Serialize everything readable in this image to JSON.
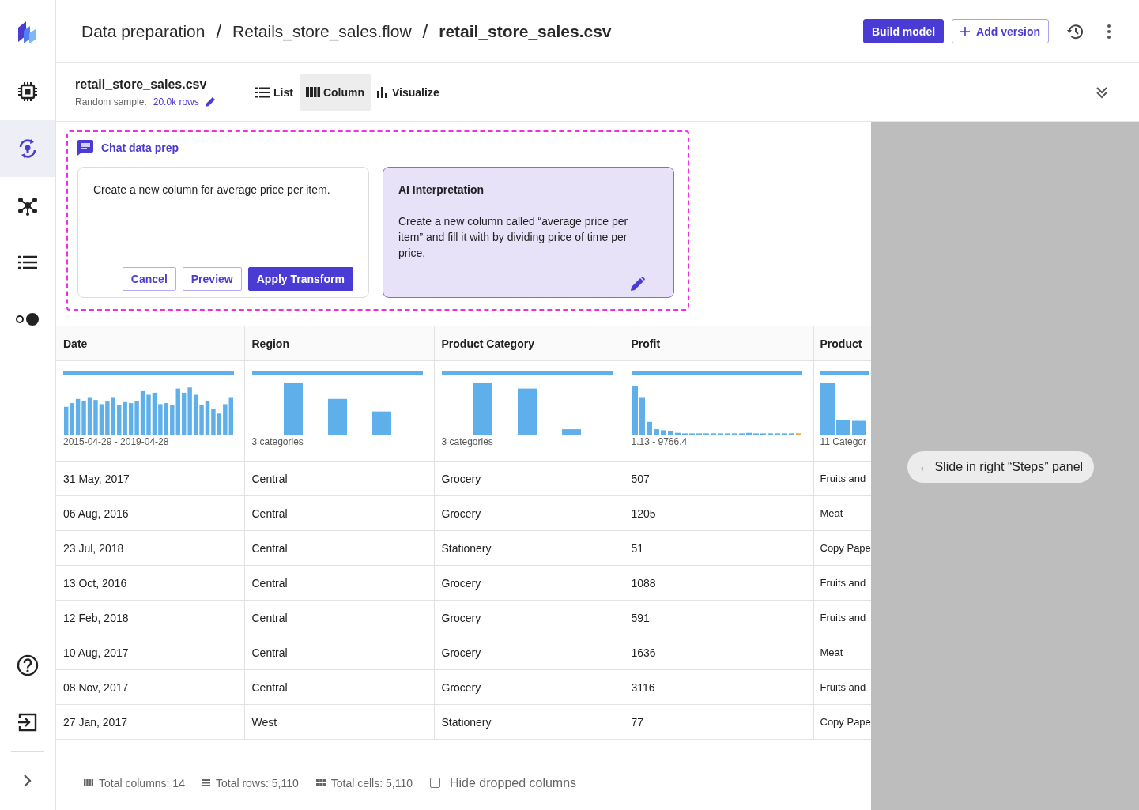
{
  "breadcrumb": {
    "separator": "/",
    "items": [
      {
        "label": "Data preparation",
        "current": false
      },
      {
        "label": "Retails_store_sales.flow",
        "current": false
      },
      {
        "label": "retail_store_sales.csv",
        "current": true
      }
    ]
  },
  "actions": {
    "primary": "Build model",
    "secondary": "Add version"
  },
  "sidebar": {
    "top": [
      {
        "kind": "chip",
        "selected": false
      },
      {
        "kind": "cycle",
        "selected": true
      },
      {
        "kind": "network",
        "selected": false
      },
      {
        "kind": "list",
        "selected": false
      },
      {
        "kind": "toggle",
        "selected": false
      }
    ],
    "bottom": [
      {
        "kind": "help"
      },
      {
        "kind": "exit"
      },
      {
        "kind": "expand"
      }
    ]
  },
  "dataset": {
    "name": "retail_store_sales.csv",
    "sample_label": "Random sample:",
    "sample_value": "20.0k rows"
  },
  "views": [
    {
      "label": "List",
      "kind": "list",
      "selected": false
    },
    {
      "label": "Column",
      "kind": "column",
      "selected": true
    },
    {
      "label": "Visualize",
      "kind": "visualize",
      "selected": false
    }
  ],
  "chat": {
    "title": "Chat data prep",
    "prompt": "Create a new column for average price per item.",
    "buttons": [
      {
        "label": "Cancel",
        "kind": "outline"
      },
      {
        "label": "Preview",
        "kind": "outline"
      },
      {
        "label": "Apply Transform",
        "kind": "primary"
      }
    ],
    "interpretation": {
      "title": "AI Interpretation",
      "text": "Create a new column called “average price per item” and fill it with by dividing price of time per price."
    }
  },
  "table": {
    "columns": [
      {
        "name": "Date",
        "summary": "2015-04-29 - 2019-04-28"
      },
      {
        "name": "Region",
        "summary": "3 categories"
      },
      {
        "name": "Product Category",
        "summary": "3 categories"
      },
      {
        "name": "Profit",
        "summary": "1.13 - 9766.4"
      },
      {
        "name": "Product",
        "summary": "11 Categor"
      }
    ],
    "rows": [
      [
        "31 May, 2017",
        "Central",
        "Grocery",
        "507",
        "Fruits and"
      ],
      [
        "06 Aug, 2016",
        "Central",
        "Grocery",
        "1205",
        "Meat"
      ],
      [
        "23 Jul, 2018",
        "Central",
        "Stationery",
        "51",
        "Copy Pape"
      ],
      [
        "13 Oct, 2016",
        "Central",
        "Grocery",
        "1088",
        "Fruits and"
      ],
      [
        "12 Feb, 2018",
        "Central",
        "Grocery",
        "591",
        "Fruits and"
      ],
      [
        "10 Aug, 2017",
        "Central",
        "Grocery",
        "1636",
        "Meat"
      ],
      [
        "08 Nov, 2017",
        "Central",
        "Grocery",
        "3116",
        "Fruits and"
      ],
      [
        "27 Jan, 2017",
        "West",
        "Stationery",
        "77",
        "Copy Pape"
      ]
    ]
  },
  "footer": {
    "stats": [
      {
        "kind": "columns",
        "label": "Total columns: 14"
      },
      {
        "kind": "rows",
        "label": "Total rows: 5,110"
      },
      {
        "kind": "cells",
        "label": "Total cells: 5,110"
      }
    ],
    "hide_dropped": {
      "label": "Hide dropped columns",
      "checked": false
    }
  },
  "overlay": {
    "hint": "← Slide in right “Steps” panel"
  }
}
